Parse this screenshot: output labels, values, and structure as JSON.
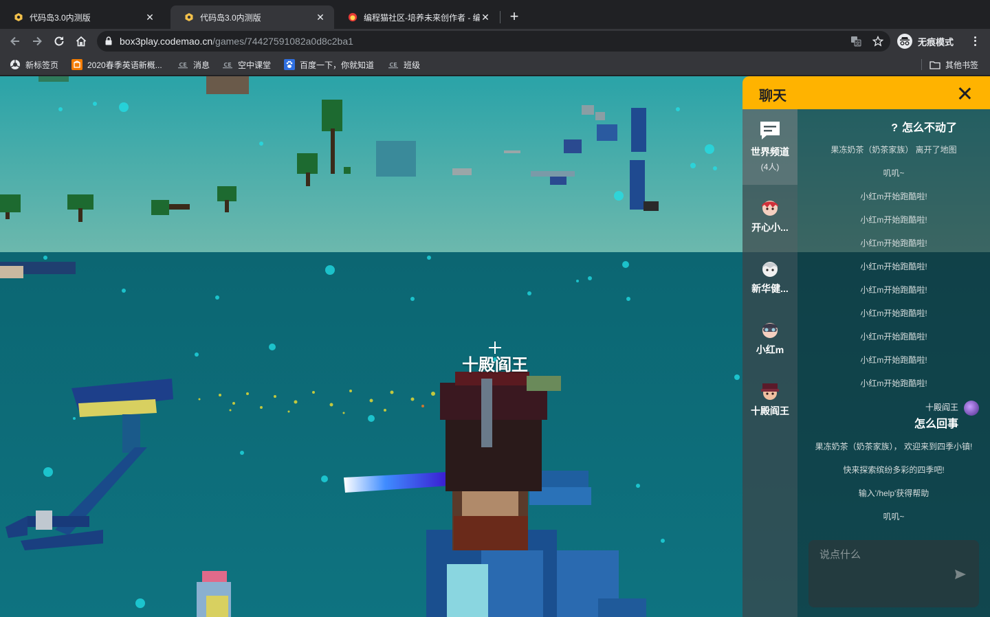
{
  "browser": {
    "tabs": [
      {
        "title": "代码岛3.0内测版",
        "active": false
      },
      {
        "title": "代码岛3.0内测版",
        "active": true
      },
      {
        "title": "编程猫社区-培养未来创作者 - 编",
        "active": false
      }
    ],
    "url_host": "box3play.codemao.cn",
    "url_path": "/games/74427591082a0d8c2ba1",
    "incognito_label": "无痕模式",
    "bookmarks": [
      {
        "label": "新标签页",
        "icon": "chrome-icon"
      },
      {
        "label": "2020春季英语新概...",
        "icon": "orange-book-icon"
      },
      {
        "label": "消息",
        "icon": "site-icon"
      },
      {
        "label": "空中课堂",
        "icon": "site-icon"
      },
      {
        "label": "百度一下，你就知道",
        "icon": "baidu-icon"
      },
      {
        "label": "班级",
        "icon": "site-icon"
      }
    ],
    "other_bookmarks": "其他书签"
  },
  "game": {
    "player_name": "十殿阎王"
  },
  "chat": {
    "title": "聊天",
    "channels": [
      {
        "label": "世界频道",
        "count": "(4人)",
        "icon": "chat-bubble-icon"
      },
      {
        "label": "开心小...",
        "icon": "avatar-red-hair"
      },
      {
        "label": "新华健...",
        "icon": "avatar-white"
      },
      {
        "label": "小红m",
        "icon": "avatar-goggles"
      },
      {
        "label": "十殿阎王",
        "icon": "avatar-hat"
      }
    ],
    "messages": [
      {
        "type": "question",
        "text": "怎么不动了"
      },
      {
        "type": "sys",
        "text": "果冻奶茶（奶茶家族） 离开了地图"
      },
      {
        "type": "sys",
        "text": "叽叽~"
      },
      {
        "type": "sys",
        "text": "小红m开始跑酷啦!"
      },
      {
        "type": "sys",
        "text": "小红m开始跑酷啦!"
      },
      {
        "type": "sys",
        "text": "小红m开始跑酷啦!"
      },
      {
        "type": "sys",
        "text": "小红m开始跑酷啦!"
      },
      {
        "type": "sys",
        "text": "小红m开始跑酷啦!"
      },
      {
        "type": "sys",
        "text": "小红m开始跑酷啦!"
      },
      {
        "type": "sys",
        "text": "小红m开始跑酷啦!"
      },
      {
        "type": "sys",
        "text": "小红m开始跑酷啦!"
      },
      {
        "type": "sys",
        "text": "小红m开始跑酷啦!"
      },
      {
        "type": "user",
        "user": "十殿阎王",
        "text": "怎么回事"
      },
      {
        "type": "sys",
        "text": "果冻奶茶（奶茶家族）， 欢迎来到四季小镇!"
      },
      {
        "type": "sys",
        "text": "快来探索缤纷多彩的四季吧!"
      },
      {
        "type": "sys",
        "text": "输入'/help'获得帮助"
      },
      {
        "type": "sys",
        "text": "叽叽~"
      }
    ],
    "input_placeholder": "说点什么"
  }
}
